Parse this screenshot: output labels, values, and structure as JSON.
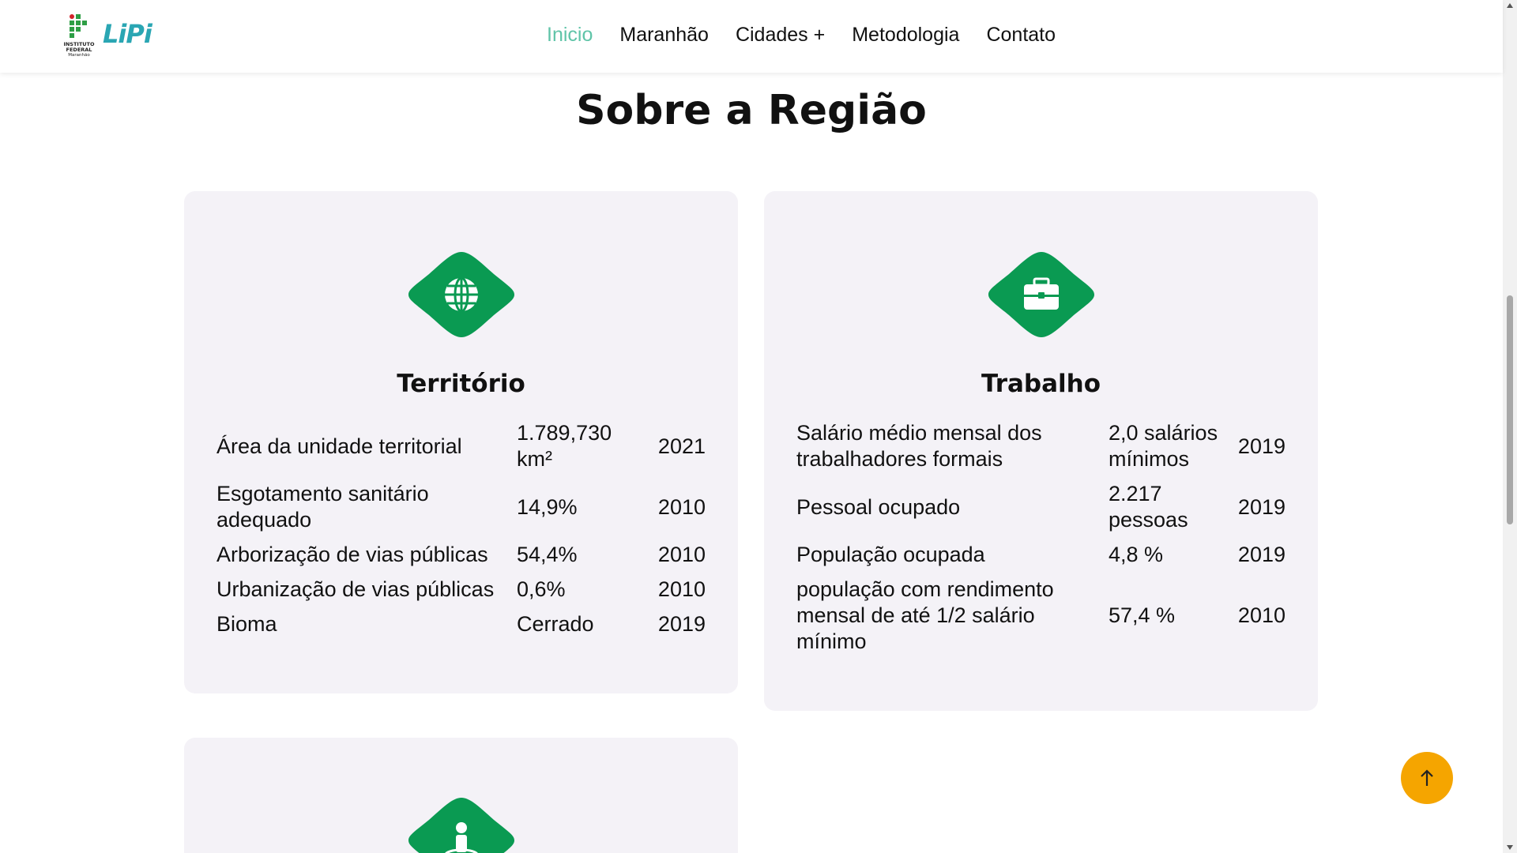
{
  "header": {
    "logo": {
      "institute_lines": [
        "INSTITUTO",
        "FEDERAL"
      ],
      "institute_sub": "Maranhão",
      "brand": "LiPi"
    },
    "nav": [
      {
        "label": "Inicio",
        "active": true
      },
      {
        "label": "Maranhão",
        "active": false
      },
      {
        "label": "Cidades +",
        "active": false
      },
      {
        "label": "Metodologia",
        "active": false
      },
      {
        "label": "Contato",
        "active": false
      }
    ]
  },
  "main": {
    "title": "Sobre a Região",
    "cards": [
      {
        "icon": "globe-icon",
        "title": "Território",
        "rows": [
          {
            "label": "Área da unidade territorial",
            "value": "1.789,730 km²",
            "year": "2021"
          },
          {
            "label": "Esgotamento sanitário adequado",
            "value": "14,9%",
            "year": "2010"
          },
          {
            "label": "Arborização de vias públicas",
            "value": "54,4%",
            "year": "2010"
          },
          {
            "label": "Urbanização de vias públicas",
            "value": "0,6%",
            "year": "2010"
          },
          {
            "label": "Bioma",
            "value": "Cerrado",
            "year": "2019"
          }
        ]
      },
      {
        "icon": "briefcase-icon",
        "title": "Trabalho",
        "rows": [
          {
            "label": "Salário médio mensal dos trabalhadores formais",
            "value": "2,0 salários mínimos",
            "year": "2019"
          },
          {
            "label": "Pessoal ocupado",
            "value": "2.217 pessoas",
            "year": "2019"
          },
          {
            "label": "População ocupada",
            "value": "4,8 %",
            "year": "2019"
          },
          {
            "label": "população com rendimento mensal de até 1/2 salário mínimo",
            "value": "57,4 %",
            "year": "2010"
          }
        ]
      },
      {
        "icon": "person-pin-icon"
      }
    ]
  },
  "colors": {
    "accent_green": "#0a9a52",
    "nav_active": "#5fc4a8",
    "card_bg": "#f4f2f7",
    "to_top": "#f5a500"
  }
}
